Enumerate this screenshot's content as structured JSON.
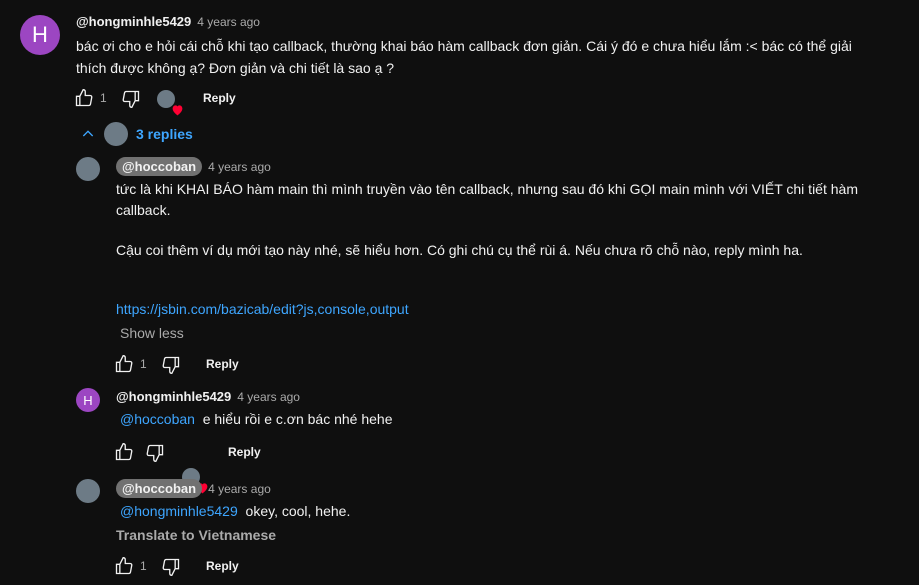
{
  "comment": {
    "avatar_letter": "H",
    "author": "@hongminhle5429",
    "time": "4 years ago",
    "text_line1": "bác ơi cho e hỏi cái chỗ khi tạo callback, thường khai báo hàm callback đơn giản. Cái ý đó e chưa hiểu lắm :< bác có thể giải",
    "text_line2": "thích được không ạ? Đơn giản và chi tiết là sao ạ ?",
    "likes": "1",
    "reply_label": "Reply",
    "replies_label": "3 replies"
  },
  "replies": [
    {
      "author": "@hoccoban",
      "time": "4 years ago",
      "line1": "tức là khi KHAI BÁO hàm main thì mình truyền vào tên callback, nhưng sau đó khi GỌI main mình với VIẾT chi tiết hàm",
      "line2": "callback.",
      "line3": "Cậu coi thêm ví dụ mới tạo này nhé, sẽ hiểu hơn. Có ghi chú cụ thể rùi á. Nếu chưa rõ chỗ nào, reply mình ha.",
      "link": "https://jsbin.com/bazicab/edit?js,console,output",
      "show_less": "Show less",
      "likes": "1",
      "reply_label": "Reply"
    },
    {
      "avatar_letter": "H",
      "author": "@hongminhle5429",
      "time": "4 years ago",
      "mention": "@hoccoban",
      "text": "e hiểu rồi e c.ơn bác nhé hehe",
      "reply_label": "Reply"
    },
    {
      "author": "@hoccoban",
      "time": "4 years ago",
      "mention": "@hongminhle5429",
      "text": "okey, cool, hehe.",
      "translate": "Translate to Vietnamese",
      "likes": "1",
      "reply_label": "Reply"
    }
  ]
}
